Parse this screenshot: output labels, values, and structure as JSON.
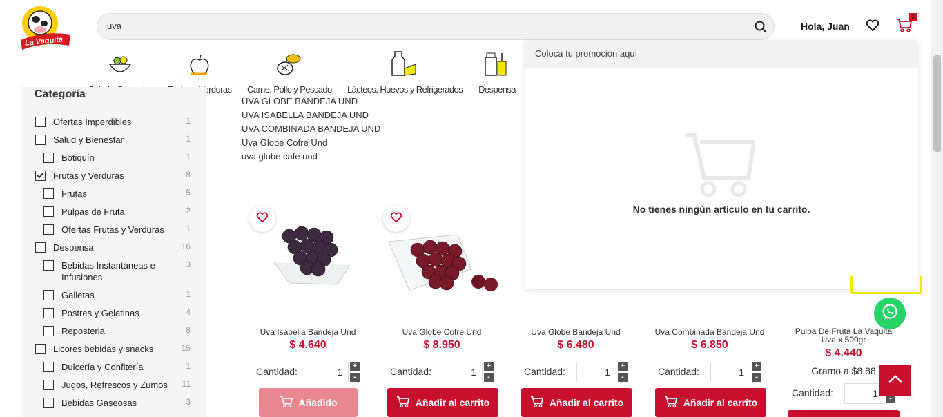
{
  "header": {
    "logo_text": "La Vaquita",
    "search_value": "uva",
    "greeting": "Hola, Juan",
    "cart_count": "0"
  },
  "categories": [
    {
      "label": "Salud y Bienestar",
      "icon": "salad-bowl-icon"
    },
    {
      "label": "Frutas y Verduras",
      "icon": "apple-icon"
    },
    {
      "label": "Carne, Pollo y Pescado",
      "icon": "meat-fish-icon"
    },
    {
      "label": "Lácteos, Huevos y Refrigerados",
      "icon": "milk-cheese-icon"
    },
    {
      "label": "Despensa",
      "icon": "pantry-icon"
    }
  ],
  "sidebar": {
    "title": "Categoría",
    "filters": [
      {
        "label": "Ofertas Imperdibles",
        "count": "1",
        "checked": false,
        "level": 0
      },
      {
        "label": "Salud y Bienestar",
        "count": "1",
        "checked": false,
        "level": 0
      },
      {
        "label": "Botiquín",
        "count": "1",
        "checked": false,
        "level": 1
      },
      {
        "label": "Frutas y Verduras",
        "count": "8",
        "checked": true,
        "level": 0
      },
      {
        "label": "Frutas",
        "count": "5",
        "checked": false,
        "level": 1
      },
      {
        "label": "Pulpas de Fruta",
        "count": "2",
        "checked": false,
        "level": 1
      },
      {
        "label": "Ofertas Frutas y Verduras",
        "count": "1",
        "checked": false,
        "level": 1
      },
      {
        "label": "Despensa",
        "count": "16",
        "checked": false,
        "level": 0
      },
      {
        "label": "Bebidas Instantáneas e Infusiones",
        "count": "3",
        "checked": false,
        "level": 1
      },
      {
        "label": "Galletas",
        "count": "1",
        "checked": false,
        "level": 1
      },
      {
        "label": "Postres y Gelatinas",
        "count": "4",
        "checked": false,
        "level": 1
      },
      {
        "label": "Reposteria",
        "count": "8",
        "checked": false,
        "level": 1
      },
      {
        "label": "Licores bebidas y snacks",
        "count": "15",
        "checked": false,
        "level": 0
      },
      {
        "label": "Dulcería y Confitería",
        "count": "1",
        "checked": false,
        "level": 1
      },
      {
        "label": "Jugos, Refrescos y Zumos",
        "count": "11",
        "checked": false,
        "level": 1
      },
      {
        "label": "Bebidas Gaseosas",
        "count": "3",
        "checked": false,
        "level": 1
      }
    ]
  },
  "suggestions": [
    "UVA GLOBE BANDEJA UND",
    "UVA ISABELLA BANDEJA UND",
    "UVA COMBINADA BANDEJA UND",
    "Uva Globe Cofre Und",
    "uva globe cafe und"
  ],
  "products": [
    {
      "name": "Uva Isabella Bandeja Und",
      "price": "$ 4.640",
      "qty_label": "Cantidad:",
      "qty": "1",
      "button": "Añadido",
      "added": true
    },
    {
      "name": "Uva Globe Cofre Und",
      "price": "$ 8.950",
      "qty_label": "Cantidad:",
      "qty": "1",
      "button": "Añadir al carrito",
      "added": false
    },
    {
      "name": "Uva Globe Bandeja Und",
      "price": "$ 6.480",
      "qty_label": "Cantidad:",
      "qty": "1",
      "button": "Añadir al carrito",
      "added": false
    },
    {
      "name": "Uva Combinada Bandeja Und",
      "price": "$ 6.850",
      "qty_label": "Cantidad:",
      "qty": "1",
      "button": "Añadir al carrito",
      "added": false
    }
  ],
  "product5": {
    "name": "Pulpa De Fruta La Vaquita Uva x 500gr",
    "price": "$ 4.440",
    "unit_price": "Gramo a $8,88",
    "qty_label": "Cantidad:",
    "qty": "1"
  },
  "qty_plus": "+",
  "qty_minus": "-",
  "cart_popup": {
    "promo": "Coloca tu promoción aquí",
    "empty_message": "No tienes ningún artículo en tu carrito."
  },
  "colors": {
    "brand_red": "#c8102e",
    "whatsapp": "#25d366",
    "promo_yellow": "#f3e600"
  }
}
